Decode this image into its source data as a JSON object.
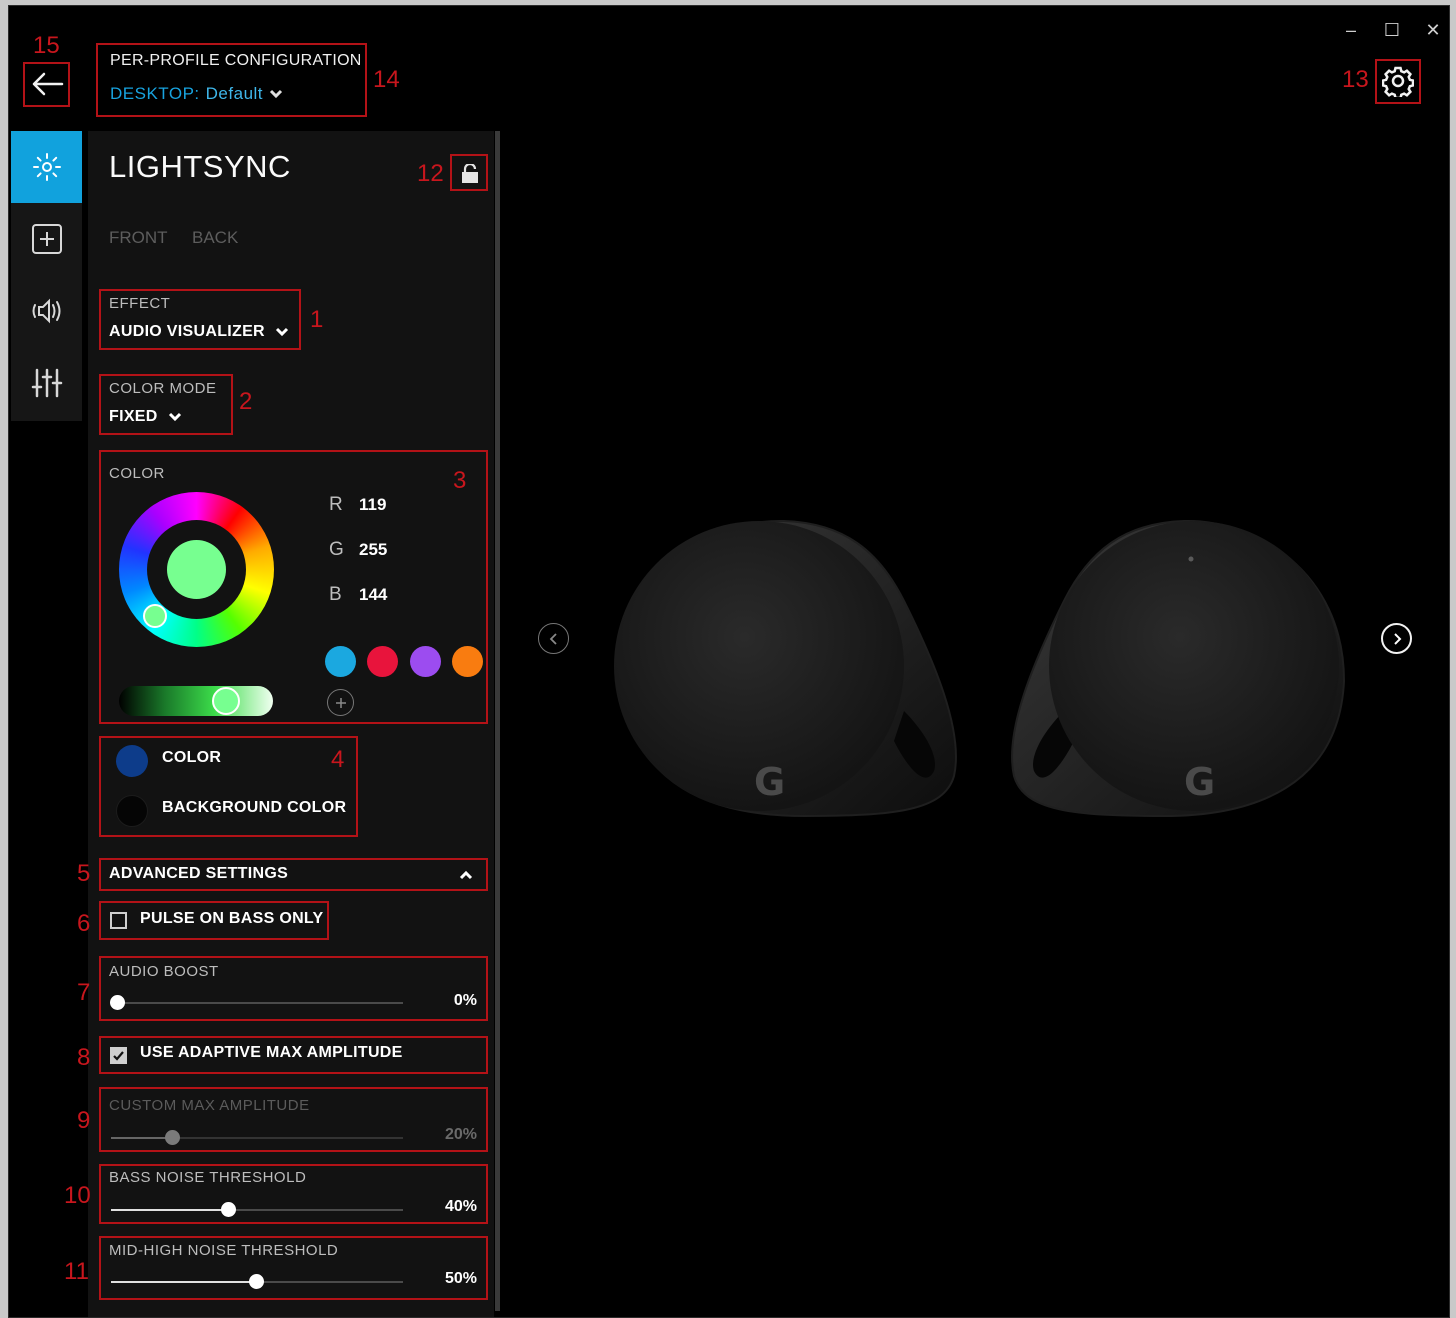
{
  "window": {
    "minimize": "–",
    "maximize": "☐",
    "close": "✕"
  },
  "header": {
    "title": "PER-PROFILE CONFIGURATION",
    "profile_prefix": "DESKTOP:",
    "profile_value": "Default"
  },
  "rail": {
    "items": [
      {
        "icon": "lightsync-sun-icon",
        "active": true
      },
      {
        "icon": "add-assignment-icon",
        "active": false
      },
      {
        "icon": "speaker-audio-icon",
        "active": false
      },
      {
        "icon": "equalizer-sliders-icon",
        "active": false
      }
    ]
  },
  "panel": {
    "title": "LIGHTSYNC",
    "zones": [
      "FRONT",
      "BACK"
    ],
    "effect": {
      "label": "EFFECT",
      "value": "AUDIO VISUALIZER"
    },
    "color_mode": {
      "label": "COLOR MODE",
      "value": "FIXED"
    },
    "color": {
      "label": "COLOR",
      "r_label": "R",
      "r": "119",
      "g_label": "G",
      "g": "255",
      "b_label": "B",
      "b": "144",
      "selected_hex": "#77ff90",
      "presets": [
        "#1ba8e0",
        "#e8143c",
        "#9c4cf0",
        "#f97c10"
      ]
    },
    "color_targets": {
      "color_label": "COLOR",
      "color_hex": "#0d3c8a",
      "background_label": "BACKGROUND COLOR",
      "background_hex": "#050505"
    },
    "advanced": {
      "label": "ADVANCED SETTINGS",
      "pulse_on_bass": {
        "label": "PULSE ON BASS ONLY",
        "checked": false
      },
      "audio_boost": {
        "label": "AUDIO BOOST",
        "value": "0%",
        "level": 0.0
      },
      "adaptive_amplitude": {
        "label": "USE ADAPTIVE MAX AMPLITUDE",
        "checked": true
      },
      "custom_max_amplitude": {
        "label": "CUSTOM MAX AMPLITUDE",
        "value": "20%",
        "level": 0.2,
        "disabled": true
      },
      "bass_noise": {
        "label": "BASS NOISE THRESHOLD",
        "value": "40%",
        "level": 0.4
      },
      "midhigh_noise": {
        "label": "MID-HIGH NOISE THRESHOLD",
        "value": "50%",
        "level": 0.5
      }
    }
  },
  "callouts": [
    "1",
    "2",
    "3",
    "4",
    "5",
    "6",
    "7",
    "8",
    "9",
    "10",
    "11",
    "12",
    "13",
    "14",
    "15"
  ],
  "colors": {
    "accent": "#11a2dd",
    "callout": "#c8161d",
    "panel": "#121212"
  }
}
